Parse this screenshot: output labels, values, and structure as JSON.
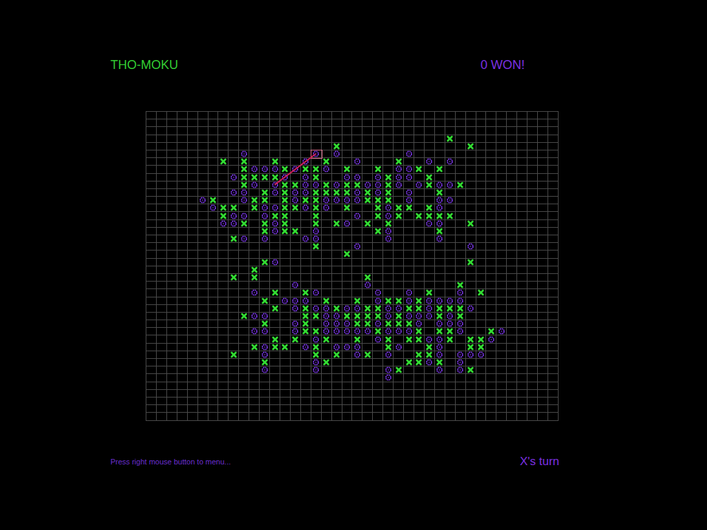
{
  "title": "THO-MOKU",
  "result": "0 WON!",
  "hint": "Press right mouse button to menu...",
  "turn": "X's turn",
  "last_move": {
    "row": 5,
    "col": 16
  },
  "win_line": {
    "from": {
      "row": 9,
      "col": 12
    },
    "to": {
      "row": 5,
      "col": 16
    }
  },
  "board": {
    "rows": [
      "........................................",
      "........................................",
      "........................................",
      ".............................X..........",
      "..................X............X........",
      ".........O......O.O......O..............",
      ".......X.X..X..O.X..O...X..O.O..........",
      ".........XOOOXOXXO.X..X.OOX.X...........",
      "........OXXXXO.OX..OO.OXOO.X............",
      ".........XO.OXXOOXOXXOOXO.OXOOX.........",
      "........OO.XOXOOXXXXOXOX.O..X...........",
      ".....OX..OXX.XOXXOOOOXXX.O..OO..........",
      "......OXX.XOOXXOXO.X..XOXX.XO...........",
      ".......XOO.OXX..X...O.XOX.XXXX..........",
      ".......OOX.XOX..X.XO.X.X...OO..X........",
      "...........XOXX.O.....XO....X...........",
      "........XO.O...OO......O....O...........",
      "................X...O..........O........",
      "...................X....................",
      "...........XO..................X........",
      "..........X.............................",
      "........X.X..........X..................",
      "..............O......O........X.........",
      "..........O.X..XO.....O..O.X..O.X.......",
      "...........X.OOO.X..X.OXXOXOOOO.........",
      "............X.OXOOXOOXXOOXXOXXXO........",
      ".........XOO...XXOOXXXXOXOOOXOX.........",
      "...........X..OX.OOOXXOXXXO.OOO.........",
      "..........OO..OXXOOOOOXOOOX.XXO..XO.....",
      "............X.X.OX..X.OX.XXOOX.XXO......",
      "..........XOXX.OX.OOO..XO..XO..XX.......",
      "........X..O....X.X.OX.O..XXO.OOO.......",
      "...........X....OX.......XXOX.O.........",
      "...........O....O......OX...O.OX........",
      ".......................O................",
      "........................................",
      "........................................",
      "........................................",
      "........................................",
      "........................................"
    ]
  }
}
